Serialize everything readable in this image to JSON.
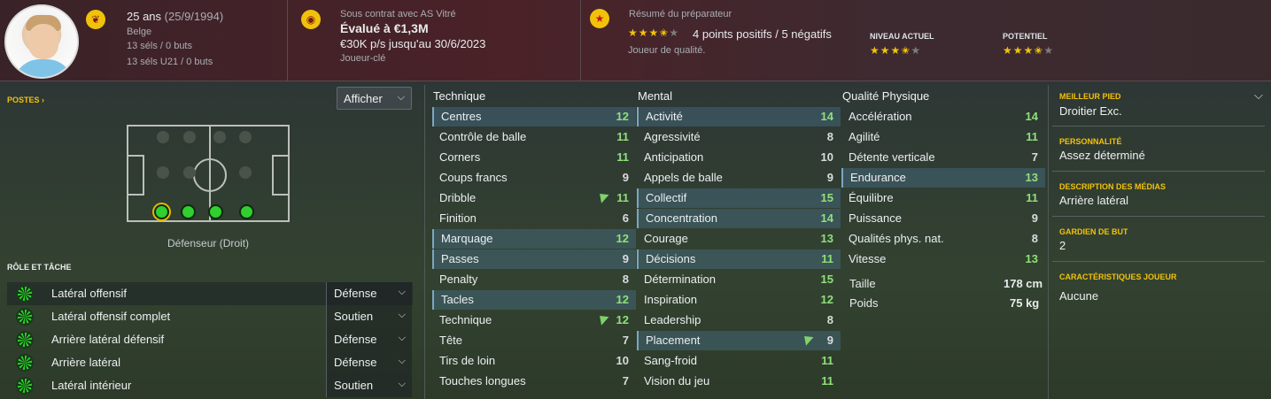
{
  "header": {
    "age": "25 ans",
    "birthdate": "(25/9/1994)",
    "nationality": "Belge",
    "caps": "13 séls / 0 buts",
    "caps_u21": "13 séls U21 / 0 buts",
    "contract": "Sous contrat avec AS Vitré",
    "value": "Évalué à €1,3M",
    "wage": "€30K p/s jusqu'au 30/6/2023",
    "squad_status": "Joueur-clé",
    "scout_title": "Résumé du préparateur",
    "scout_rating_stars": 3.5,
    "scout_points": "4 points positifs / 5 négatifs",
    "scout_summary": "Joueur de qualité.",
    "current_label": "NIVEAU ACTUEL",
    "current_stars": 3.5,
    "potential_label": "POTENTIEL",
    "potential_stars": 3.5
  },
  "positions": {
    "title": "POSTES ›",
    "show_button": "Afficher",
    "position_label": "Défenseur (Droit)"
  },
  "roles": {
    "title": "RÔLE ET TÂCHE",
    "items": [
      {
        "name": "Latéral offensif",
        "duty": "Défense"
      },
      {
        "name": "Latéral offensif complet",
        "duty": "Soutien"
      },
      {
        "name": "Arrière latéral défensif",
        "duty": "Défense"
      },
      {
        "name": "Arrière latéral",
        "duty": "Défense"
      },
      {
        "name": "Latéral intérieur",
        "duty": "Soutien"
      }
    ]
  },
  "technique": {
    "title": "Technique",
    "attrs": [
      {
        "name": "Centres",
        "value": "12"
      },
      {
        "name": "Contrôle de balle",
        "value": "11"
      },
      {
        "name": "Corners",
        "value": "11"
      },
      {
        "name": "Coups francs",
        "value": "9"
      },
      {
        "name": "Dribble",
        "value": "11"
      },
      {
        "name": "Finition",
        "value": "6"
      },
      {
        "name": "Marquage",
        "value": "12"
      },
      {
        "name": "Passes",
        "value": "9"
      },
      {
        "name": "Penalty",
        "value": "8"
      },
      {
        "name": "Tacles",
        "value": "12"
      },
      {
        "name": "Technique",
        "value": "12"
      },
      {
        "name": "Tête",
        "value": "7"
      },
      {
        "name": "Tirs de loin",
        "value": "10"
      },
      {
        "name": "Touches longues",
        "value": "7"
      }
    ]
  },
  "mental": {
    "title": "Mental",
    "attrs": [
      {
        "name": "Activité",
        "value": "14"
      },
      {
        "name": "Agressivité",
        "value": "8"
      },
      {
        "name": "Anticipation",
        "value": "10"
      },
      {
        "name": "Appels de balle",
        "value": "9"
      },
      {
        "name": "Collectif",
        "value": "15"
      },
      {
        "name": "Concentration",
        "value": "14"
      },
      {
        "name": "Courage",
        "value": "13"
      },
      {
        "name": "Décisions",
        "value": "11"
      },
      {
        "name": "Détermination",
        "value": "15"
      },
      {
        "name": "Inspiration",
        "value": "12"
      },
      {
        "name": "Leadership",
        "value": "8"
      },
      {
        "name": "Placement",
        "value": "9"
      },
      {
        "name": "Sang-froid",
        "value": "11"
      },
      {
        "name": "Vision du jeu",
        "value": "11"
      }
    ]
  },
  "physical": {
    "title": "Qualité Physique",
    "attrs": [
      {
        "name": "Accélération",
        "value": "14"
      },
      {
        "name": "Agilité",
        "value": "11"
      },
      {
        "name": "Détente verticale",
        "value": "7"
      },
      {
        "name": "Endurance",
        "value": "13"
      },
      {
        "name": "Équilibre",
        "value": "11"
      },
      {
        "name": "Puissance",
        "value": "9"
      },
      {
        "name": "Qualités phys. nat.",
        "value": "8"
      },
      {
        "name": "Vitesse",
        "value": "13"
      }
    ],
    "height_label": "Taille",
    "height": "178 cm",
    "weight_label": "Poids",
    "weight": "75 kg"
  },
  "side": {
    "foot_label": "MEILLEUR PIED",
    "foot": "Droitier Exc.",
    "personality_label": "PERSONNALITÉ",
    "personality": "Assez déterminé",
    "media_label": "DESCRIPTION DES MÉDIAS",
    "media": "Arrière latéral",
    "gk_label": "GARDIEN DE BUT",
    "gk": "2",
    "traits_label": "CARACTÉRISTIQUES JOUEUR",
    "traits": "Aucune"
  },
  "colors": {
    "accent": "#f2c20a",
    "good_value": "#8fe07a",
    "highlight_row": "#466e87"
  }
}
